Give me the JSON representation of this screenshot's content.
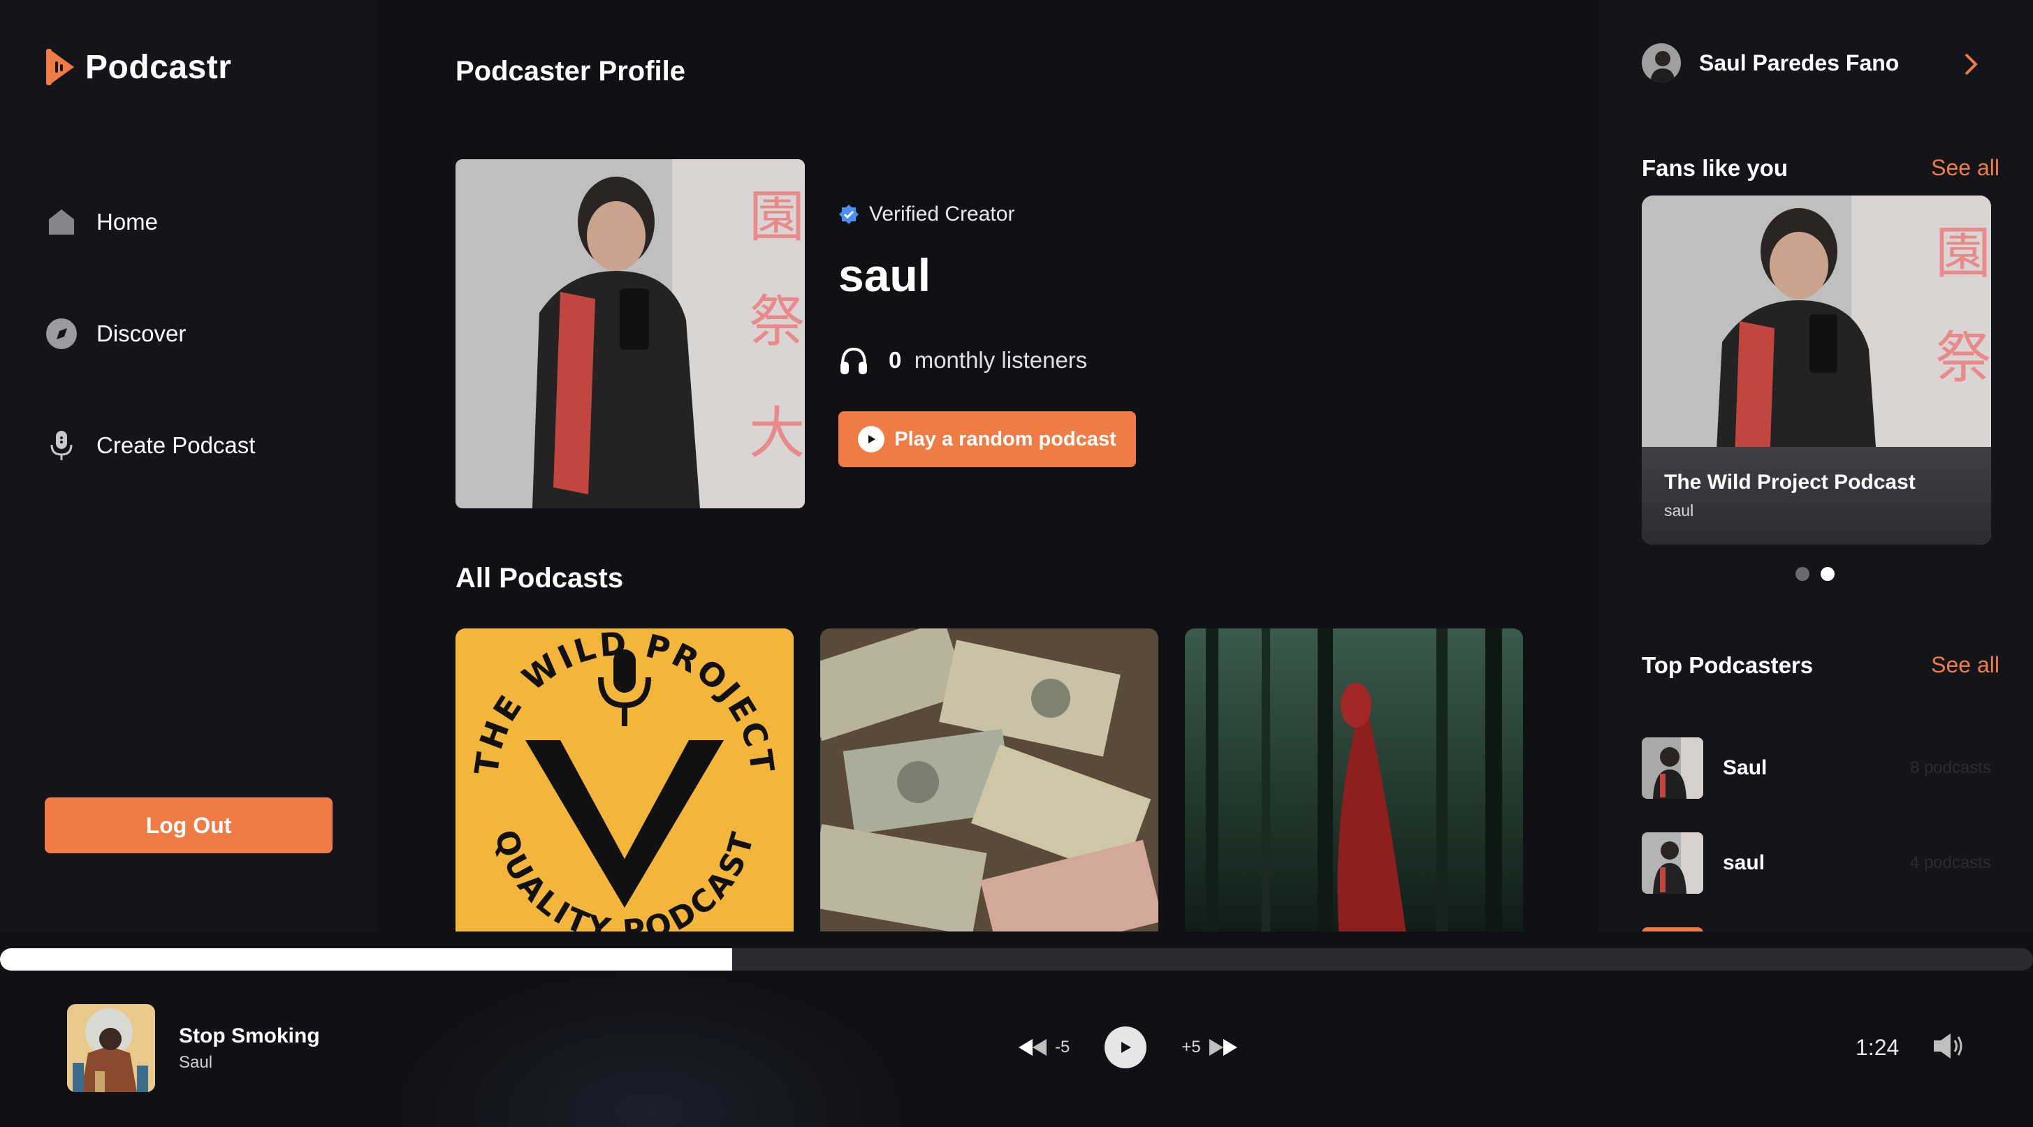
{
  "app": {
    "name": "Podcastr",
    "accent": "#f07c45"
  },
  "nav": {
    "items": [
      {
        "label": "Home",
        "icon": "home-icon"
      },
      {
        "label": "Discover",
        "icon": "discover-icon"
      },
      {
        "label": "Create Podcast",
        "icon": "microphone-icon"
      }
    ],
    "logout_label": "Log Out"
  },
  "main": {
    "page_title": "Podcaster Profile",
    "profile": {
      "verified_label": "Verified Creator",
      "name": "saul",
      "listeners_count": "0",
      "listeners_label": "monthly listeners",
      "play_random_label": "Play a random podcast"
    },
    "all_podcasts_title": "All Podcasts",
    "podcasts": [
      {
        "cover_text": "THE WILD PROJECT QUALITY PODCAST"
      },
      {
        "cover": "money-image"
      },
      {
        "cover": "forest-red-cloak-image"
      }
    ]
  },
  "right": {
    "user_name": "Saul Paredes Fano",
    "fans": {
      "heading": "Fans like you",
      "see_all": "See all",
      "card": {
        "title": "The Wild Project Podcast",
        "author": "saul"
      },
      "slides": 2,
      "active_slide": 2
    },
    "top": {
      "heading": "Top Podcasters",
      "see_all": "See all",
      "items": [
        {
          "name": "Saul",
          "count": "8 podcasts"
        },
        {
          "name": "saul",
          "count": "4 podcasts"
        }
      ]
    }
  },
  "player": {
    "progress": 0.36,
    "title": "Stop Smoking",
    "author": "Saul",
    "rewind_label": "-5",
    "forward_label": "+5",
    "time": "1:24"
  }
}
